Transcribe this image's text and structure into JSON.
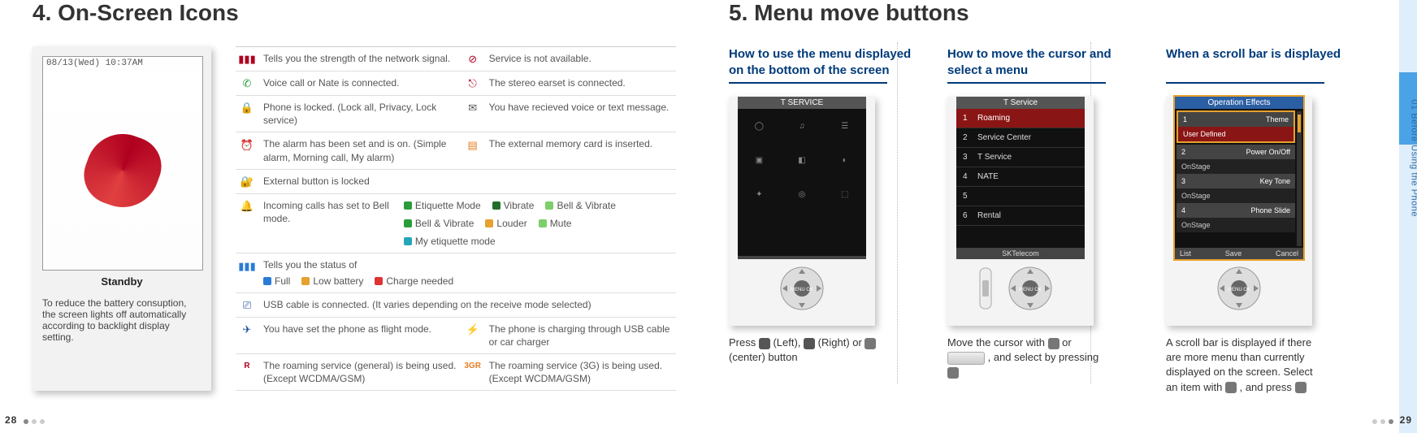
{
  "left": {
    "heading": "4. On-Screen Icons",
    "phone": {
      "status": "08/13(Wed) 10:37AM",
      "label": "Standby",
      "note": "To reduce the battery consuption, the screen lights off automatically according to backlight display setting."
    },
    "rows": {
      "r1a": "Tells you the strength of the network signal.",
      "r1b": "Service is not available.",
      "r2a": "Voice call or Nate is connected.",
      "r2b": "The stereo earset is connected.",
      "r3a": "Phone is locked. (Lock all, Privacy, Lock service)",
      "r3b": "You have recieved voice or text message.",
      "r4a": "The alarm has been set and is on. (Simple alarm, Morning call, My alarm)",
      "r4b": "The external memory card is inserted.",
      "r5a": "External button is locked",
      "r6a": "Incoming calls has set to Bell mode.",
      "r6_modes": {
        "m1": "Etiquette Mode",
        "m2": "Vibrate",
        "m3": "Bell & Vibrate",
        "m4": "Bell & Vibrate",
        "m5": "Louder",
        "m6": "Mute",
        "m7": "My etiquette mode"
      },
      "r7a": "Tells you the status of",
      "r7_modes": {
        "m1": "Full",
        "m2": "Low battery",
        "m3": "Charge needed"
      },
      "r8a": "USB cable is connected. (It varies depending on the receive mode selected)",
      "r9a": "You have set the phone as flight mode.",
      "r9b": "The phone is charging through USB cable or car charger",
      "r10a": "The roaming service (general) is being used. (Except WCDMA/GSM)",
      "r10b": "The roaming service (3G) is being used. (Except WCDMA/GSM)"
    },
    "page_num": "28"
  },
  "right": {
    "heading": "5. Menu move buttons",
    "side_label": "01 Before Using the Phone",
    "cols": {
      "c1": {
        "title": "How to use the menu displayed on the bottom of the screen",
        "screen": {
          "header": "T SERVICE"
        },
        "caption_pre": "Press ",
        "caption_left": " (Left), ",
        "caption_right": " (Right) or ",
        "caption_center": " (center) button"
      },
      "c2": {
        "title": "How to move the cursor and select a menu",
        "screen": {
          "header": "T Service",
          "items": [
            "Roaming",
            "Service Center",
            "T Service",
            "NATE",
            "",
            "Rental"
          ],
          "provider": "SKTelecom"
        },
        "caption_pre": "Move the cursor with ",
        "caption_or": " or ",
        "caption_mid": " , and select by pressing "
      },
      "c3": {
        "title": "When a scroll bar is displayed",
        "screen": {
          "header": "Operation Effects",
          "items": [
            {
              "k": "Theme"
            },
            {
              "k": "User Defined",
              "sel": true
            },
            {
              "k": "Power On/Off"
            },
            {
              "k": "OnStage"
            },
            {
              "k": "Key Tone"
            },
            {
              "k": "OnStage"
            },
            {
              "k": "Phone Slide"
            },
            {
              "k": "OnStage"
            }
          ],
          "soft": [
            "List",
            "Save",
            "Cancel"
          ]
        },
        "caption": "A scroll bar is displayed if there are more menu than currently displayed on the screen. Select an item with ",
        "caption_mid": " , and press "
      }
    },
    "page_num": "29"
  }
}
